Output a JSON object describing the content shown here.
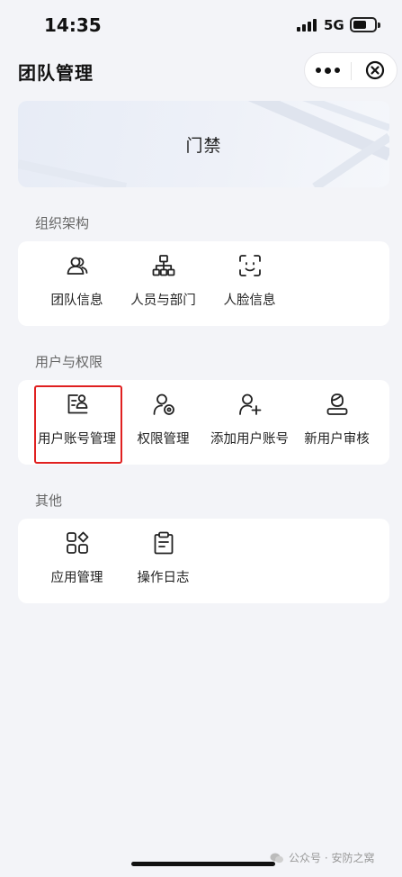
{
  "status_bar": {
    "time": "14:35",
    "network": "5G"
  },
  "header": {
    "title": "团队管理"
  },
  "banner": {
    "title": "门禁"
  },
  "sections": [
    {
      "title": "组织架构",
      "items": [
        {
          "label": "团队信息",
          "icon": "team-icon"
        },
        {
          "label": "人员与部门",
          "icon": "org-chart-icon"
        },
        {
          "label": "人脸信息",
          "icon": "face-scan-icon"
        }
      ]
    },
    {
      "title": "用户与权限",
      "items": [
        {
          "label": "用户账号管理",
          "icon": "user-account-icon"
        },
        {
          "label": "权限管理",
          "icon": "user-permission-icon"
        },
        {
          "label": "添加用户账号",
          "icon": "add-user-icon"
        },
        {
          "label": "新用户审核",
          "icon": "user-review-icon"
        }
      ]
    },
    {
      "title": "其他",
      "items": [
        {
          "label": "应用管理",
          "icon": "apps-icon"
        },
        {
          "label": "操作日志",
          "icon": "clipboard-log-icon"
        }
      ]
    }
  ],
  "watermark": {
    "text": "公众号 · 安防之窝"
  },
  "colors": {
    "highlight": "#e02020",
    "background": "#f3f4f8"
  }
}
